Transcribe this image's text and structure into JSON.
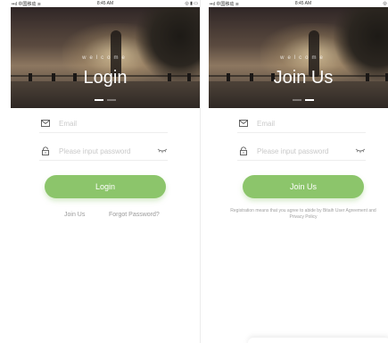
{
  "status_bar": {
    "carrier": "••ıl 中国移动 ≋",
    "time": "8:45 AM",
    "right": "◎ ▮ ▭"
  },
  "login_screen": {
    "welcome": "welcome",
    "title": "Login",
    "email_placeholder": "Email",
    "password_placeholder": "Please input password",
    "button_label": "Login",
    "join_link": "Join Us",
    "forgot_link": "Forgot Password?"
  },
  "join_screen": {
    "welcome": "welcome",
    "title": "Join Us",
    "email_placeholder": "Email",
    "password_placeholder": "Please input password",
    "button_label": "Join Us",
    "terms": "Registration means that you agree to abide by Bitaih User Agreement and Privacy Policy"
  },
  "colors": {
    "accent": "#8cc56b",
    "placeholder": "#c9c9c9",
    "link": "#9a9a9a"
  },
  "icons": {
    "email": "envelope-icon",
    "password": "padlock-icon",
    "visibility": "eye-closed-icon"
  }
}
